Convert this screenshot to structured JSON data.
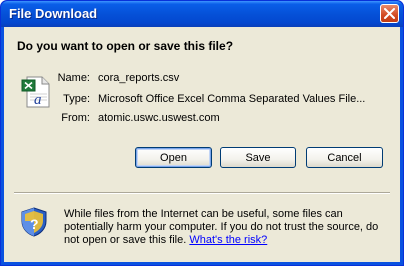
{
  "window": {
    "title": "File Download"
  },
  "dialog": {
    "question": "Do you want to open or save this file?",
    "name_label": "Name:",
    "name_value": "cora_reports.csv",
    "type_label": "Type:",
    "type_value": "Microsoft Office Excel Comma Separated Values File...",
    "from_label": "From:",
    "from_value": "atomic.uswc.uswest.com",
    "buttons": {
      "open": "Open",
      "save": "Save",
      "cancel": "Cancel"
    },
    "warning_text": "While files from the Internet can be useful, some files can potentially harm your computer. If you do not trust the source, do not open or save this file.",
    "risk_link": "What's the risk?"
  },
  "icons": {
    "file": "excel-csv-file-icon",
    "close": "close-icon",
    "security": "shield-icon"
  },
  "colors": {
    "titlebar": "#0551d8",
    "client_bg": "#ece9d8",
    "close_button": "#d24a22",
    "link": "#0000ff"
  }
}
